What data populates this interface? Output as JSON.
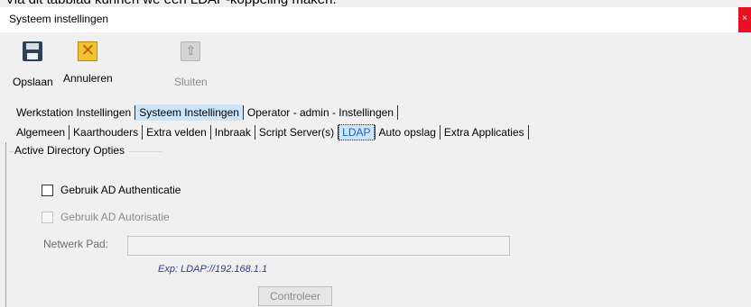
{
  "top_caption": "Via dit tabblad kunnen we een LDAP-koppeling maken.",
  "window": {
    "title": "Systeem instellingen",
    "close_glyph": "×"
  },
  "toolbar": {
    "save": {
      "label": "Opslaan",
      "icon": "save-icon"
    },
    "cancel": {
      "label": "Annuleren",
      "icon": "cancel-icon"
    },
    "close": {
      "label": "Sluiten",
      "icon": "exit-icon",
      "disabled": true
    }
  },
  "main_tabs": [
    {
      "label": "Werkstation Instellingen"
    },
    {
      "label": "Systeem Instellingen",
      "selected": true
    },
    {
      "label": "Operator - admin - Instellingen"
    }
  ],
  "sub_tabs": [
    {
      "label": "Algemeen"
    },
    {
      "label": "Kaarthouders"
    },
    {
      "label": "Extra velden"
    },
    {
      "label": "Inbraak"
    },
    {
      "label": "Script Server(s)"
    },
    {
      "label": "LDAP",
      "selected": true
    },
    {
      "label": "Auto opslag"
    },
    {
      "label": "Extra Applicaties"
    }
  ],
  "ldap": {
    "group_title": "Active Directory Opties",
    "use_ad_auth": {
      "label": "Gebruik AD Authenticatie",
      "checked": false
    },
    "use_ad_authorization": {
      "label": "Gebruik AD Autorisatie",
      "checked": false,
      "disabled": true
    },
    "network_path": {
      "label": "Netwerk Pad:",
      "value": ""
    },
    "example": "Exp: LDAP://192.168.1.1",
    "check_button": "Controleer"
  }
}
